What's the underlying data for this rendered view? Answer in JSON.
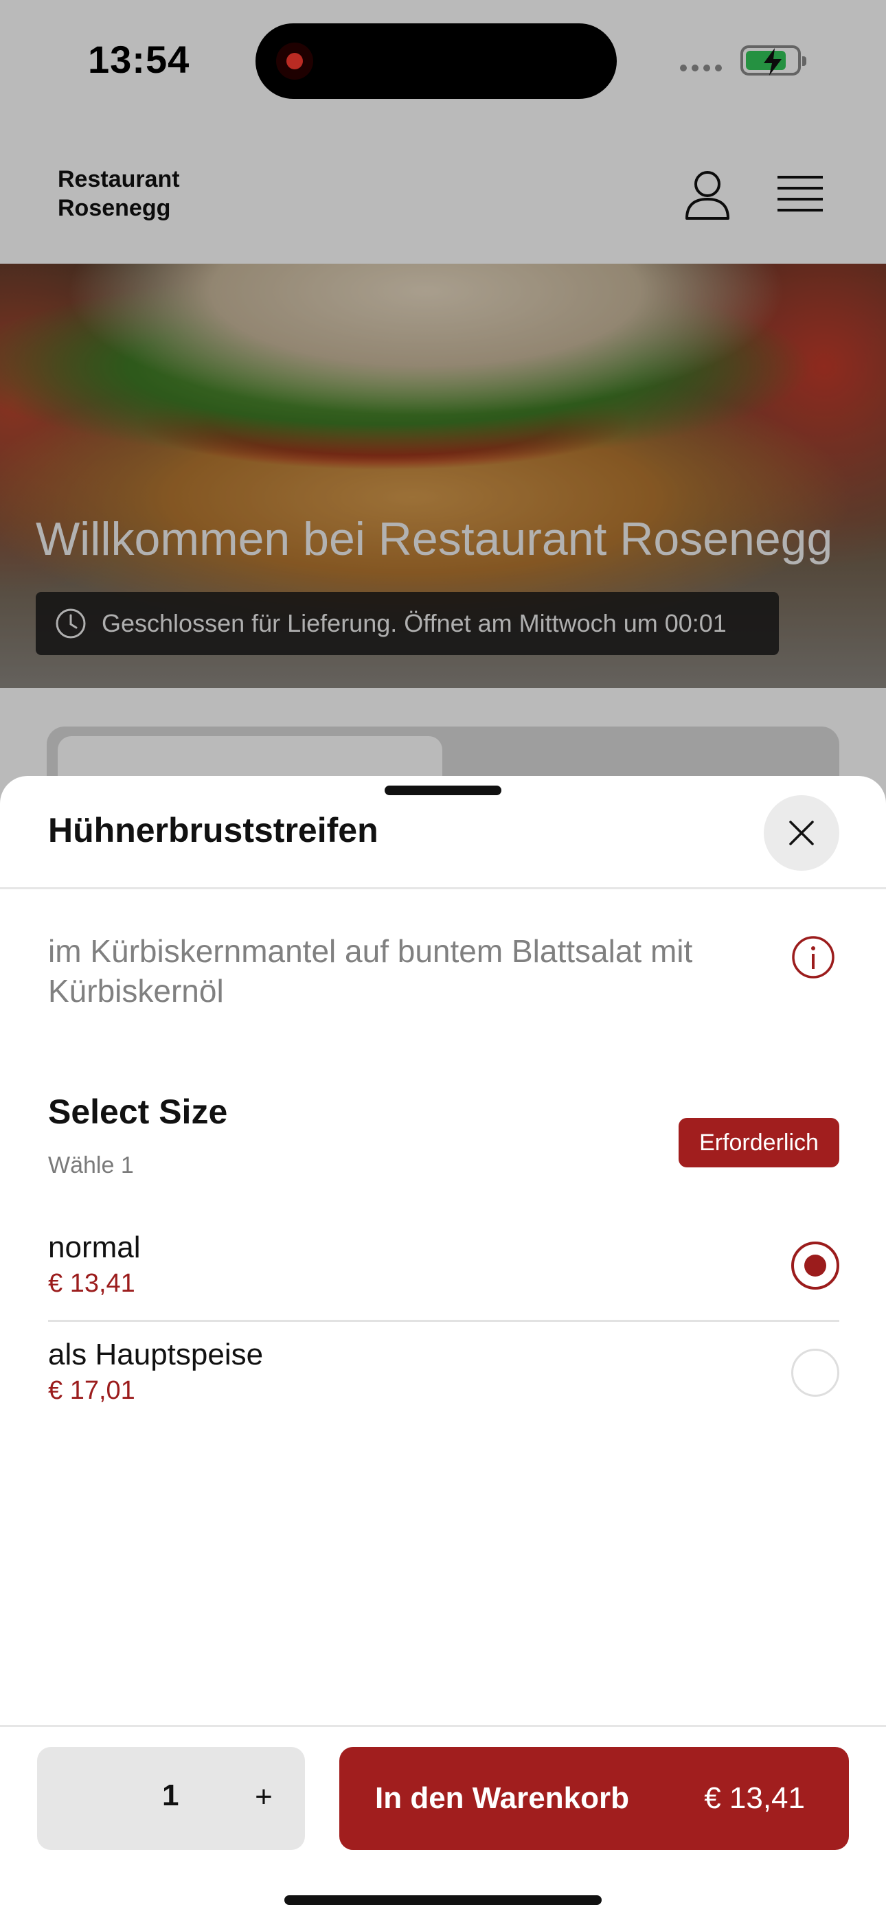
{
  "status_bar": {
    "time": "13:54"
  },
  "header": {
    "brand": "Restaurant\nRosenegg"
  },
  "hero": {
    "title": "Willkommen bei Restaurant Rosenegg",
    "notice": "Geschlossen für Lieferung. Öffnet am Mittwoch um 00:01"
  },
  "sheet": {
    "title": "Hühnerbruststreifen",
    "description": "im Kürbiskernmantel auf buntem Blattsalat mit Kürbiskernöl",
    "section": {
      "title": "Select Size",
      "subtitle": "Wähle 1",
      "badge": "Erforderlich"
    },
    "options": [
      {
        "name": "normal",
        "price": "€ 13,41",
        "selected": true
      },
      {
        "name": "als Hauptspeise",
        "price": "€ 17,01",
        "selected": false
      }
    ],
    "footer": {
      "quantity": "1",
      "plus": "+",
      "add_label": "In den Warenkorb",
      "add_price": "€ 13,41"
    }
  },
  "colors": {
    "accent": "#9b1c1c",
    "badge": "#a11e1e"
  },
  "icons": {
    "user": "user-icon",
    "menu": "hamburger-menu-icon",
    "close": "close-icon",
    "info": "info-icon",
    "clock": "clock-icon"
  }
}
